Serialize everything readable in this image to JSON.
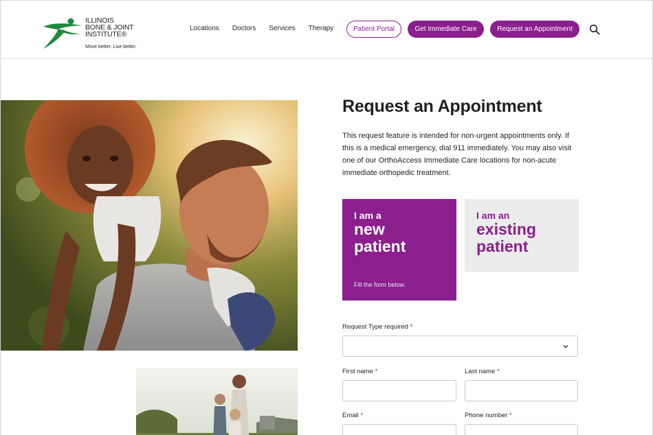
{
  "logo": {
    "line1": "ILLINOIS",
    "line2": "BONE & JOINT",
    "line3": "INSTITUTE®",
    "tagline": "Move better. Live better.",
    "brand_green": "#1f8a3c"
  },
  "nav": {
    "items": [
      {
        "label": "Locations"
      },
      {
        "label": "Doctors"
      },
      {
        "label": "Services"
      },
      {
        "label": "Therapy"
      }
    ],
    "patient_portal": "Patient Portal",
    "immediate_care": "Get Immediate Care",
    "request_appointment": "Request an Appointment",
    "search_icon": "search-icon"
  },
  "page": {
    "title": "Request an Appointment",
    "intro": "This request feature is intended for non-urgent appointments only. If this is a medical emergency, dial 911 immediately. You may also visit one of our OrthoAccess Immediate Care locations for non-acute immediate orthopedic treatment."
  },
  "cards": {
    "new": {
      "prefix": "I am a",
      "line1": "new",
      "line2": "patient",
      "note": "Fill the form below."
    },
    "existing": {
      "prefix": "I am an",
      "line1": "existing",
      "line2": "patient"
    }
  },
  "form": {
    "request_type_label": "Request Type required",
    "request_type_value": "",
    "first_name_label": "First name",
    "last_name_label": "Last name",
    "email_label": "Email",
    "phone_label": "Phone number",
    "required_mark": "*"
  },
  "colors": {
    "accent": "#8a1f8d",
    "card_grey": "#ececec",
    "text": "#231f20"
  }
}
